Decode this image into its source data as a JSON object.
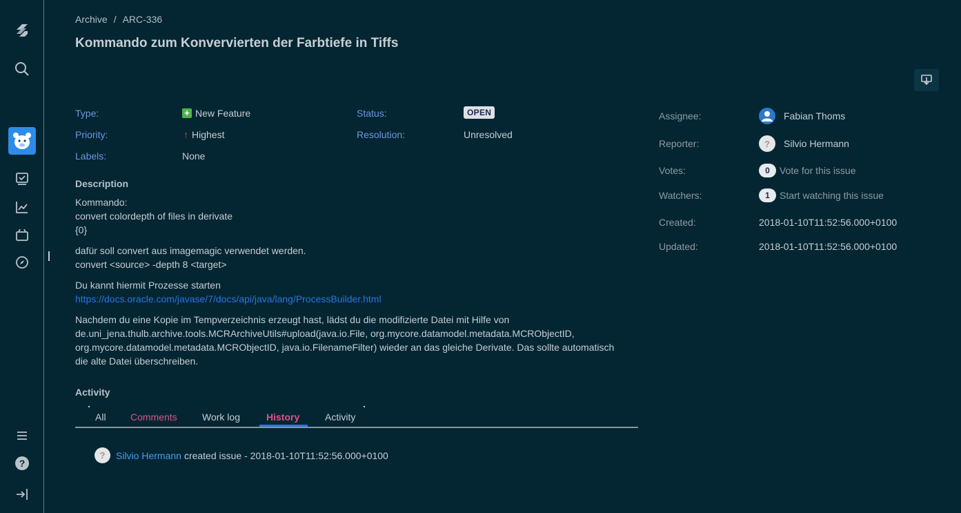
{
  "breadcrumb": {
    "project": "Archive",
    "separator": "/",
    "issue_key": "ARC-336"
  },
  "issue": {
    "title": "Kommando zum Konvervierten der Farbtiefe in Tiffs"
  },
  "fields": {
    "type_label": "Type:",
    "type_value": "New Feature",
    "priority_label": "Priority:",
    "priority_value": "Highest",
    "labels_label": "Labels:",
    "labels_value": "None",
    "status_label": "Status:",
    "status_value": "OPEN",
    "resolution_label": "Resolution:",
    "resolution_value": "Unresolved"
  },
  "description": {
    "heading": "Description",
    "p1_l1": "Kommando:",
    "p1_l2": "convert colordepth of files in derivate",
    "p1_l3": "{0}",
    "p2_l1": "dafür soll convert aus imagemagic verwendet werden.",
    "p2_l2": "convert <source> -depth 8 <target>",
    "p3_l1": "Du kannt hiermit Prozesse starten",
    "p3_link": "https://docs.oracle.com/javase/7/docs/api/java/lang/ProcessBuilder.html",
    "p4_l1": "Nachdem du eine Kopie im Tempverzeichnis erzeugt hast, lädst du die modifizierte Datei mit Hilfe von",
    "p4_l2": "de.uni_jena.thulb.archive.tools.MCRArchiveUtils#upload(java.io.File, org.mycore.datamodel.metadata.MCRObjectID,",
    "p4_l3": "org.mycore.datamodel.metadata.MCRObjectID, java.io.FilenameFilter) wieder an das gleiche Derivate. Das sollte automatisch",
    "p4_l4": "die alte Datei überschreiben."
  },
  "activity": {
    "heading": "Activity",
    "tabs": [
      "All",
      "Comments",
      "Work log",
      "History",
      "Activity"
    ],
    "active_tab": "History",
    "history": {
      "user": "Silvio Hermann",
      "text": "created issue - 2018-01-10T11:52:56.000+0100"
    }
  },
  "people": {
    "assignee_label": "Assignee:",
    "assignee": "Fabian Thoms",
    "reporter_label": "Reporter:",
    "reporter": "Silvio Hermann",
    "votes_label": "Votes:",
    "votes_count": "0",
    "votes_action": "Vote for this issue",
    "watchers_label": "Watchers:",
    "watchers_count": "1",
    "watchers_action": "Start watching this issue"
  },
  "dates": {
    "created_label": "Created:",
    "created": "2018-01-10T11:52:56.000+0100",
    "updated_label": "Updated:",
    "updated": "2018-01-10T11:52:56.000+0100"
  },
  "colors": {
    "background": "#042632",
    "label_blue": "#6d96e0",
    "link": "#2a74de",
    "tab_pink": "#e0508a"
  },
  "icons": [
    "jira-logo-icon",
    "search-icon",
    "project-avatar-icon",
    "board-icon",
    "reports-icon",
    "releases-icon",
    "compass-icon",
    "menu-icon",
    "help-icon",
    "logout-icon",
    "export-icon"
  ]
}
